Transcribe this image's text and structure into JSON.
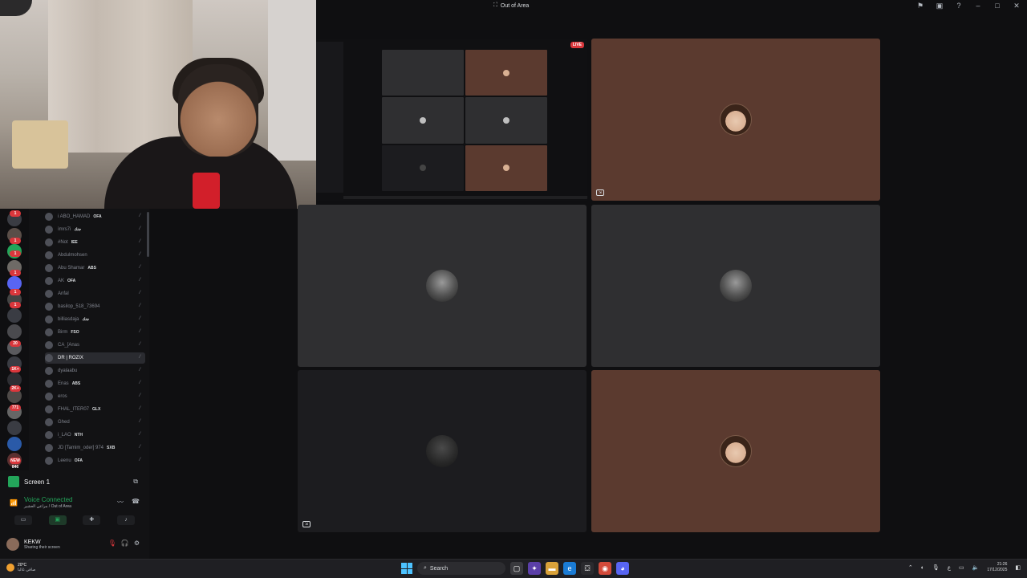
{
  "window": {
    "title": "Out of Area"
  },
  "stream": {
    "live_label": "LIVE"
  },
  "members": [
    {
      "name": "i ABO_HAMAD",
      "tag": "OFA"
    },
    {
      "name": "ìmrs7i",
      "tag": "جنك"
    },
    {
      "name": "#Not",
      "tag": "IEE"
    },
    {
      "name": "Abdulmohsen",
      "tag": ""
    },
    {
      "name": "Abu Shamar",
      "tag": "ABS"
    },
    {
      "name": "AK",
      "tag": "OFA"
    },
    {
      "name": "Anfal",
      "tag": ""
    },
    {
      "name": "basilop_518_73694",
      "tag": ""
    },
    {
      "name": "billiasdaja",
      "tag": "جنك"
    },
    {
      "name": "Birm",
      "tag": "FSO"
    },
    {
      "name": "CA_[Anas",
      "tag": ""
    },
    {
      "name": "DR | ROZIX",
      "tag": ""
    },
    {
      "name": "dyalaabu",
      "tag": ""
    },
    {
      "name": "Enas",
      "tag": "ABS"
    },
    {
      "name": "eros",
      "tag": ""
    },
    {
      "name": "FHAL_ITER07",
      "tag": "GLX"
    },
    {
      "name": "Ghed",
      "tag": ""
    },
    {
      "name": "i_LAO",
      "tag": "NTH"
    },
    {
      "name": "JD [Tamim_oder] 974",
      "tag": "SXB"
    },
    {
      "name": "Leenu",
      "tag": "OFA"
    }
  ],
  "server_badges": [
    "1",
    "1",
    "1",
    "1",
    "1",
    "1",
    "20",
    "1K+",
    "2K+",
    "771",
    "NEW 846"
  ],
  "panel": {
    "screen_label": "Screen 1",
    "voice_status": "Voice Connected",
    "voice_channel": "مراعي العشير / Out of Area",
    "user_name": "KEKW",
    "user_status": "Sharing their screen"
  },
  "taskbar": {
    "temp": "20°C",
    "weather": "صافي غالبا",
    "search_placeholder": "Search",
    "time": "21:26",
    "date": "17/12/2025",
    "lang": "ع"
  },
  "icons": {
    "title": "server-icon",
    "mic": "mic-off-icon",
    "stream": "screen-share-icon"
  },
  "colors": {
    "live": "#da373c",
    "voice_green": "#23a55a",
    "tile_brown": "#5b3a2f"
  }
}
